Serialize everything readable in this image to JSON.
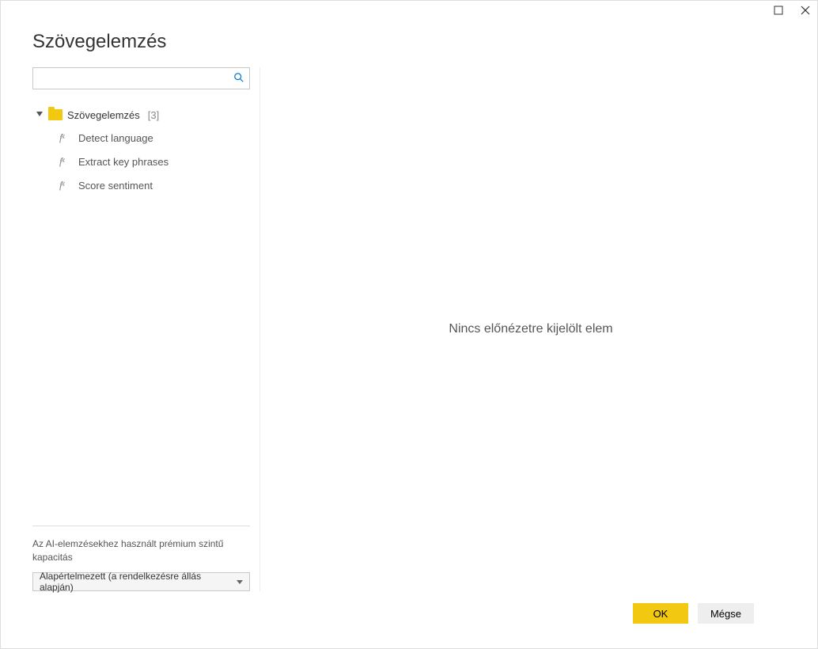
{
  "title": "Szövegelemzés",
  "search": {
    "value": ""
  },
  "tree": {
    "folder": {
      "label": "Szövegelemzés",
      "count": "[3]"
    },
    "items": [
      {
        "label": "Detect language"
      },
      {
        "label": "Extract key phrases"
      },
      {
        "label": "Score sentiment"
      }
    ]
  },
  "capacity": {
    "label": "Az AI-elemzésekhez használt prémium szintű kapacitás",
    "dropdown": "Alapértelmezett (a rendelkezésre állás alapján)"
  },
  "preview": {
    "empty_text": "Nincs előnézetre kijelölt elem"
  },
  "footer": {
    "ok": "OK",
    "cancel": "Mégse"
  }
}
